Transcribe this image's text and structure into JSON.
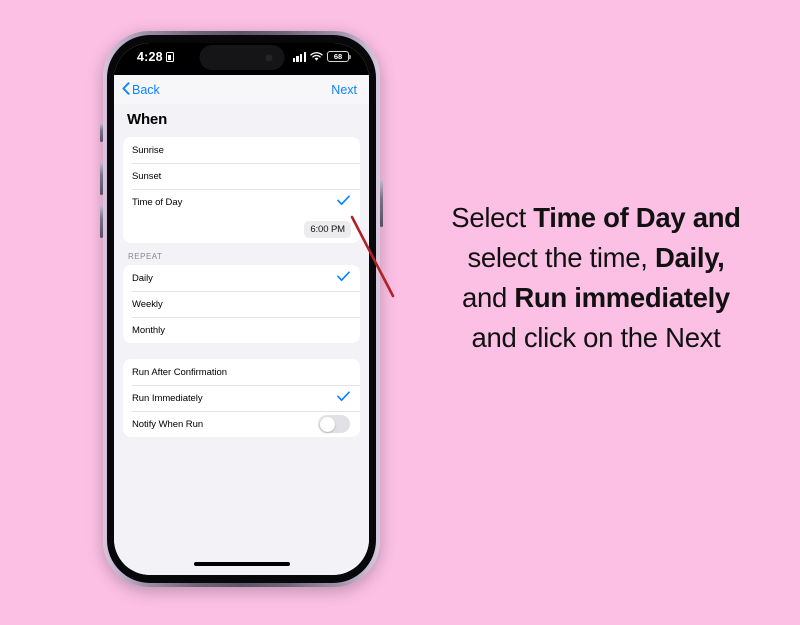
{
  "background_color": "#fcc0e5",
  "accent_color": "#0a84ff",
  "phone": {
    "status_bar": {
      "time": "4:28",
      "lock_icon": "lock-icon",
      "signal_icon": "cellular-signal-icon",
      "wifi_icon": "wifi-icon",
      "battery_level": "68"
    },
    "nav_bar": {
      "back_label": "Back",
      "back_icon": "chevron-left-icon",
      "next_label": "Next"
    },
    "page_title": "When",
    "sections": [
      {
        "header": "",
        "rows": [
          {
            "label": "Sunrise",
            "checked": false
          },
          {
            "label": "Sunset",
            "checked": false
          },
          {
            "label": "Time of Day",
            "checked": true
          }
        ],
        "time_value": "6:00 PM"
      },
      {
        "header": "REPEAT",
        "rows": [
          {
            "label": "Daily",
            "checked": true
          },
          {
            "label": "Weekly",
            "checked": false
          },
          {
            "label": "Monthly",
            "checked": false
          }
        ]
      },
      {
        "header": "",
        "rows": [
          {
            "label": "Run After Confirmation",
            "checked": false
          },
          {
            "label": "Run Immediately",
            "checked": true
          },
          {
            "label": "Notify When Run",
            "checked": false,
            "toggle": "off"
          }
        ]
      }
    ],
    "home_indicator": "home-indicator"
  },
  "annotation": {
    "pointer_color": "#b3202a",
    "line1_pre": "Select ",
    "line1_bold": "Time of Day and",
    "line2_pre": "select the time, ",
    "line2_bold": "Daily,",
    "line3_pre": "and ",
    "line3_bold": "Run immediately",
    "line4": "and click on the Next"
  }
}
